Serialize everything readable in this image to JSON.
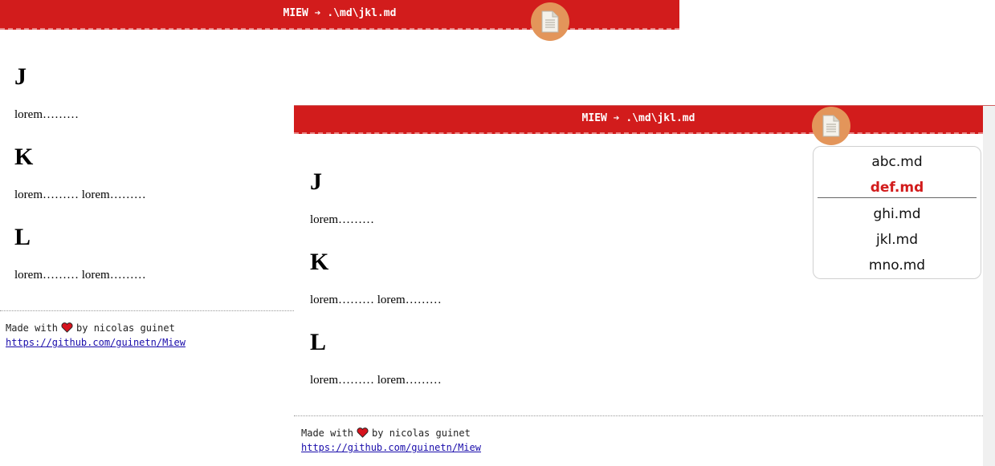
{
  "back_window": {
    "header_title": "MIEW ➔ .\\md\\jkl.md",
    "sections": [
      {
        "heading": "J",
        "text": "lorem……… "
      },
      {
        "heading": "K",
        "text": "lorem……… lorem………"
      },
      {
        "heading": "L",
        "text": "lorem……… lorem………"
      }
    ],
    "footer": {
      "made_with": "Made with",
      "by": "by nicolas guinet",
      "link": "https://github.com/guinetn/Miew"
    }
  },
  "front_window": {
    "header_title": "MIEW ➔ .\\md\\jkl.md",
    "sections": [
      {
        "heading": "J",
        "text": "lorem……… "
      },
      {
        "heading": "K",
        "text": "lorem……… lorem………"
      },
      {
        "heading": "L",
        "text": "lorem……… lorem………"
      }
    ],
    "footer": {
      "made_with": "Made with",
      "by": "by nicolas guinet",
      "link": "https://github.com/guinetn/Miew"
    },
    "file_menu": {
      "items": [
        "abc.md",
        "def.md",
        "ghi.md",
        "jkl.md",
        "mno.md"
      ],
      "active_item": "def.md"
    }
  },
  "icons": {
    "document_button": "document-icon",
    "heart": "heart-icon"
  },
  "colors": {
    "header_red": "#d21c1c",
    "doc_button_orange": "#e3955a",
    "active_file": "#d21c1c",
    "link_blue": "#1a0dab"
  }
}
